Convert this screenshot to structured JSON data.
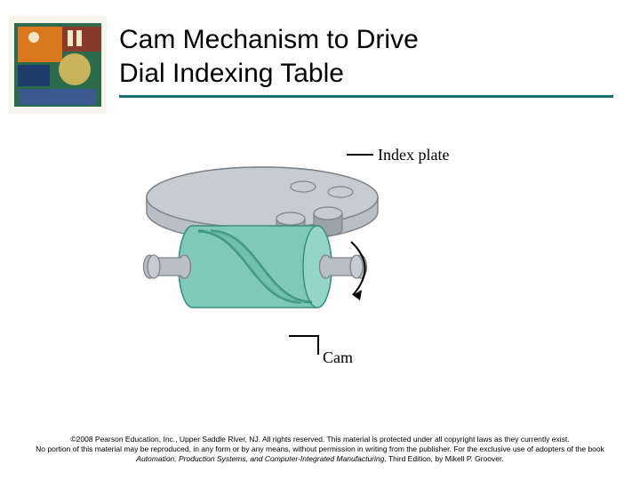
{
  "title": {
    "line1": "Cam Mechanism to Drive",
    "line2": "Dial Indexing Table"
  },
  "labels": {
    "index_plate": "Index plate",
    "cam": "Cam"
  },
  "colors": {
    "accent": "#1a6e6c",
    "plate": "#b9bfc4",
    "plate_outline": "#7e8388",
    "cam": "#7ec9b8",
    "cam_outline": "#3a8f7e",
    "shaft": "#b9bfc4"
  },
  "footer": {
    "line1": "©2008 Pearson Education, Inc., Upper Saddle River, NJ. All rights reserved. This material is protected under all copyright laws as they currently exist.",
    "line2_prefix": "No portion of this material may be reproduced, in any form or by any means, without permission in writing from the publisher. For the exclusive use of adopters of the book ",
    "line2_title": "Automation, Production Systems, and Computer-Integrated Manufacturing,",
    "line2_suffix": " Third Edition, by Mikell P. Groover."
  }
}
